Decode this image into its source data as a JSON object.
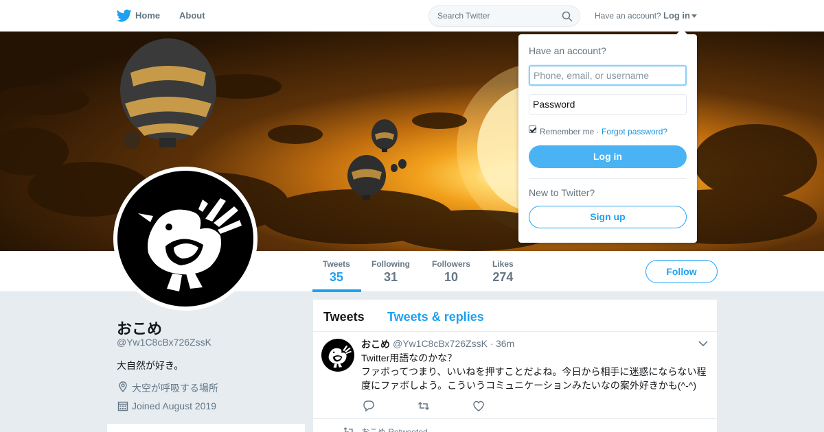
{
  "nav": {
    "home_label": "Home",
    "about_label": "About",
    "search_placeholder": "Search Twitter",
    "have_account_text": "Have an account?",
    "login_label": "Log in"
  },
  "profile": {
    "name": "おこめ",
    "handle": "@Yw1C8cBx726ZssK",
    "bio": "大自然が好き。",
    "location": "大空が呼吸する場所",
    "joined": "Joined August 2019",
    "follow_label": "Follow",
    "stats": [
      {
        "label": "Tweets",
        "value": "35"
      },
      {
        "label": "Following",
        "value": "31"
      },
      {
        "label": "Followers",
        "value": "10"
      },
      {
        "label": "Likes",
        "value": "274"
      }
    ]
  },
  "timeline": {
    "tabs": [
      {
        "label": "Tweets"
      },
      {
        "label": "Tweets & replies"
      }
    ],
    "tweet": {
      "name": "おこめ",
      "handle": "@Yw1C8cBx726ZssK",
      "separator": "·",
      "time": "36m",
      "text": "Twitter用語なのかな？\nファボってつまり、いいねを押すことだよね。今日から相手に迷惑にならない程度にファボしよう。こういうコミュニケーションみたいなの案外好きかも(^-^)"
    },
    "retweet_context": "おこめ Retweeted"
  },
  "login_dropdown": {
    "title": "Have an account?",
    "username_placeholder": "Phone, email, or username",
    "password_placeholder": "Password",
    "remember_label": "Remember me",
    "separator": "·",
    "forgot_label": "Forgot password?",
    "login_button": "Log in",
    "new_title": "New to Twitter?",
    "signup_button": "Sign up"
  },
  "colors": {
    "accent": "#1da1f2",
    "login_button_bg": "#4ab3f4",
    "secondary_text": "#657786",
    "page_bg": "#e6ecf0"
  },
  "icons": [
    "twitter-bird-icon",
    "search-icon",
    "location-pin-icon",
    "calendar-icon",
    "chevron-down-icon",
    "reply-icon",
    "retweet-icon",
    "like-icon"
  ]
}
